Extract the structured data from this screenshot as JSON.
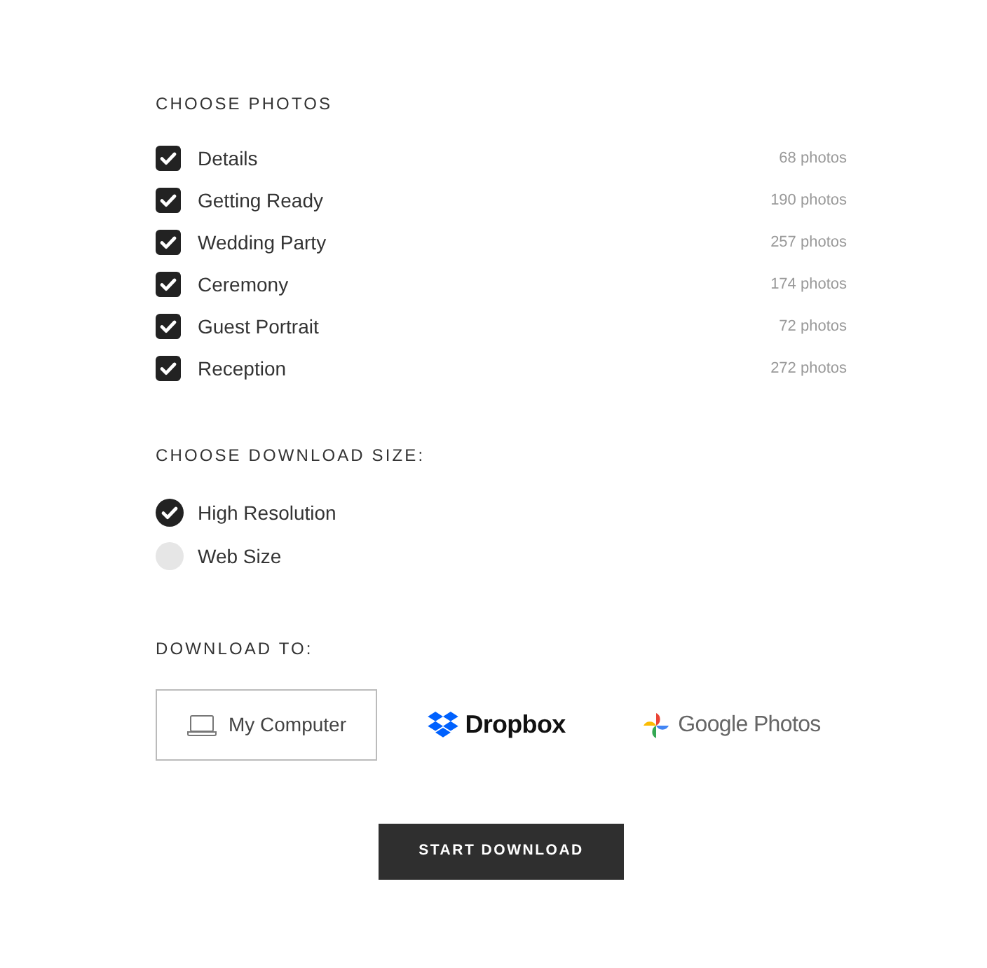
{
  "photos_section": {
    "heading": "CHOOSE PHOTOS",
    "items": [
      {
        "label": "Details",
        "count": "68 photos",
        "checked": true
      },
      {
        "label": "Getting Ready",
        "count": "190 photos",
        "checked": true
      },
      {
        "label": "Wedding Party",
        "count": "257 photos",
        "checked": true
      },
      {
        "label": "Ceremony",
        "count": "174 photos",
        "checked": true
      },
      {
        "label": "Guest Portrait",
        "count": "72 photos",
        "checked": true
      },
      {
        "label": "Reception",
        "count": "272 photos",
        "checked": true
      }
    ]
  },
  "size_section": {
    "heading": "CHOOSE DOWNLOAD SIZE:",
    "options": [
      {
        "label": "High Resolution",
        "selected": true
      },
      {
        "label": "Web Size",
        "selected": false
      }
    ]
  },
  "destination_section": {
    "heading": "DOWNLOAD TO:",
    "options": [
      {
        "kind": "computer",
        "label": "My Computer",
        "selected": true
      },
      {
        "kind": "dropbox",
        "label": "Dropbox",
        "selected": false
      },
      {
        "kind": "google-photos",
        "label": "Google Photos",
        "selected": false
      }
    ]
  },
  "start_button": "START DOWNLOAD"
}
